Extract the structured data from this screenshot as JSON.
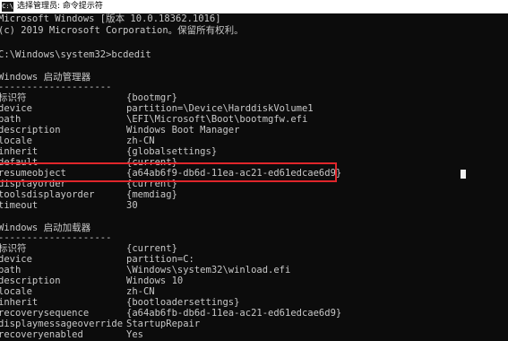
{
  "titlebar": {
    "icon_label": "C:\\",
    "title": "选择管理员: 命令提示符"
  },
  "header_lines": [
    "Microsoft Windows [版本 10.0.18362.1016]",
    "(c) 2019 Microsoft Corporation。保留所有权利。",
    "C:\\Windows\\system32>bcdedit"
  ],
  "boot_manager": {
    "heading": "Windows 启动管理器",
    "underline": "--------------------",
    "rows": [
      {
        "key": "标识符",
        "value": "{bootmgr}"
      },
      {
        "key": "device",
        "value": "partition=\\Device\\HarddiskVolume1"
      },
      {
        "key": "path",
        "value": "\\EFI\\Microsoft\\Boot\\bootmgfw.efi"
      },
      {
        "key": "description",
        "value": "Windows Boot Manager"
      },
      {
        "key": "locale",
        "value": "zh-CN"
      },
      {
        "key": "inherit",
        "value": "{globalsettings}"
      },
      {
        "key": "default",
        "value": "{current}"
      },
      {
        "key": "resumeobject",
        "value": "{a64ab6f9-db6d-11ea-ac21-ed61edcae6d9}"
      },
      {
        "key": "displayorder",
        "value": "{current}"
      },
      {
        "key": "toolsdisplayorder",
        "value": "{memdiag}"
      },
      {
        "key": "timeout",
        "value": "30"
      }
    ]
  },
  "boot_loader": {
    "heading": "Windows 启动加载器",
    "underline": "--------------------",
    "rows": [
      {
        "key": "标识符",
        "value": "{current}"
      },
      {
        "key": "device",
        "value": "partition=C:"
      },
      {
        "key": "path",
        "value": "\\Windows\\system32\\winload.efi"
      },
      {
        "key": "description",
        "value": "Windows 10"
      },
      {
        "key": "locale",
        "value": "zh-CN"
      },
      {
        "key": "inherit",
        "value": "{bootloadersettings}"
      },
      {
        "key": "recoverysequence",
        "value": "{a64ab6fb-db6d-11ea-ac21-ed61edcae6d9}"
      },
      {
        "key": "displaymessageoverride",
        "value": "StartupRepair"
      },
      {
        "key": "recoveryenabled",
        "value": "Yes"
      }
    ]
  },
  "colors": {
    "background": "#0c0c0c",
    "text": "#c8c8c8",
    "highlight_border": "#e0262b"
  }
}
